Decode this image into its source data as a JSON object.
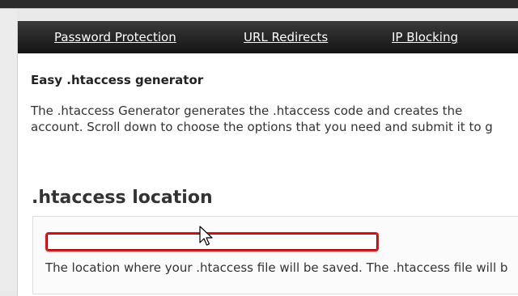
{
  "nav": {
    "items": [
      {
        "label": "Password Protection"
      },
      {
        "label": "URL Redirects"
      },
      {
        "label": "IP Blocking"
      }
    ]
  },
  "generator": {
    "heading": "Easy .htaccess generator",
    "intro_line1": "The .htaccess Generator generates the .htaccess code and creates the",
    "intro_line2": "account. Scroll down to choose the options that you need and submit it to g"
  },
  "location": {
    "title": ".htaccess location",
    "input_value": "",
    "help_text": "The location where your .htaccess file will be saved. The .htaccess file will b"
  }
}
